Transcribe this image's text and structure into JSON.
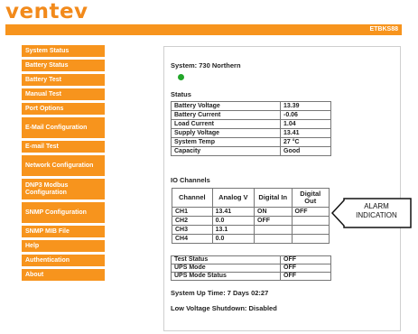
{
  "brand": {
    "logo_text": "ventev",
    "device_id": "ETBKS88"
  },
  "sidebar": {
    "items": [
      {
        "label": "System Status"
      },
      {
        "label": "Battery Status"
      },
      {
        "label": "Battery Test"
      },
      {
        "label": "Manual Test"
      },
      {
        "label": "Port Options"
      },
      {
        "label": "E-Mail Configuration"
      },
      {
        "label": "E-mail Test"
      },
      {
        "label": "Network Configuration"
      },
      {
        "label": "DNP3 Modbus Configuration"
      },
      {
        "label": "SNMP Configuration"
      },
      {
        "label": "SNMP MIB File"
      },
      {
        "label": "Help"
      },
      {
        "label": "Authentication"
      },
      {
        "label": "About"
      }
    ]
  },
  "main": {
    "system_title": "System: 730 Northern",
    "status_label": "Status",
    "status_rows": [
      {
        "label": "Battery Voltage",
        "value": "13.39"
      },
      {
        "label": "Battery Current",
        "value": "-0.06"
      },
      {
        "label": "Load Current",
        "value": "1.04"
      },
      {
        "label": "Supply Voltage",
        "value": "13.41"
      },
      {
        "label": "System Temp",
        "value": "27 °C"
      },
      {
        "label": "Capacity",
        "value": "Good"
      }
    ],
    "io_label": "IO Channels",
    "io_headers": {
      "channel": "Channel",
      "analog": "Analog V",
      "digital_in": "Digital In",
      "digital_out": "Digital Out"
    },
    "io_rows": [
      {
        "channel": "CH1",
        "analog": "13.41",
        "din": "ON",
        "dout": "OFF"
      },
      {
        "channel": "CH2",
        "analog": "0.0",
        "din": "OFF",
        "dout": ""
      },
      {
        "channel": "CH3",
        "analog": "13.1",
        "din": "",
        "dout": ""
      },
      {
        "channel": "CH4",
        "analog": "0.0",
        "din": "",
        "dout": ""
      }
    ],
    "bottom_rows": [
      {
        "label": "Test Status",
        "value": "OFF"
      },
      {
        "label": "UPS Mode",
        "value": "OFF"
      },
      {
        "label": "UPS Mode Status",
        "value": "OFF"
      }
    ],
    "uptime": "System Up Time: 7 Days 02:27",
    "shutdown": "Low Voltage Shutdown: Disabled"
  },
  "callout": {
    "line1": "ALARM",
    "line2": "INDICATION"
  },
  "colors": {
    "accent": "#f7941d",
    "led": "#22a62a"
  }
}
